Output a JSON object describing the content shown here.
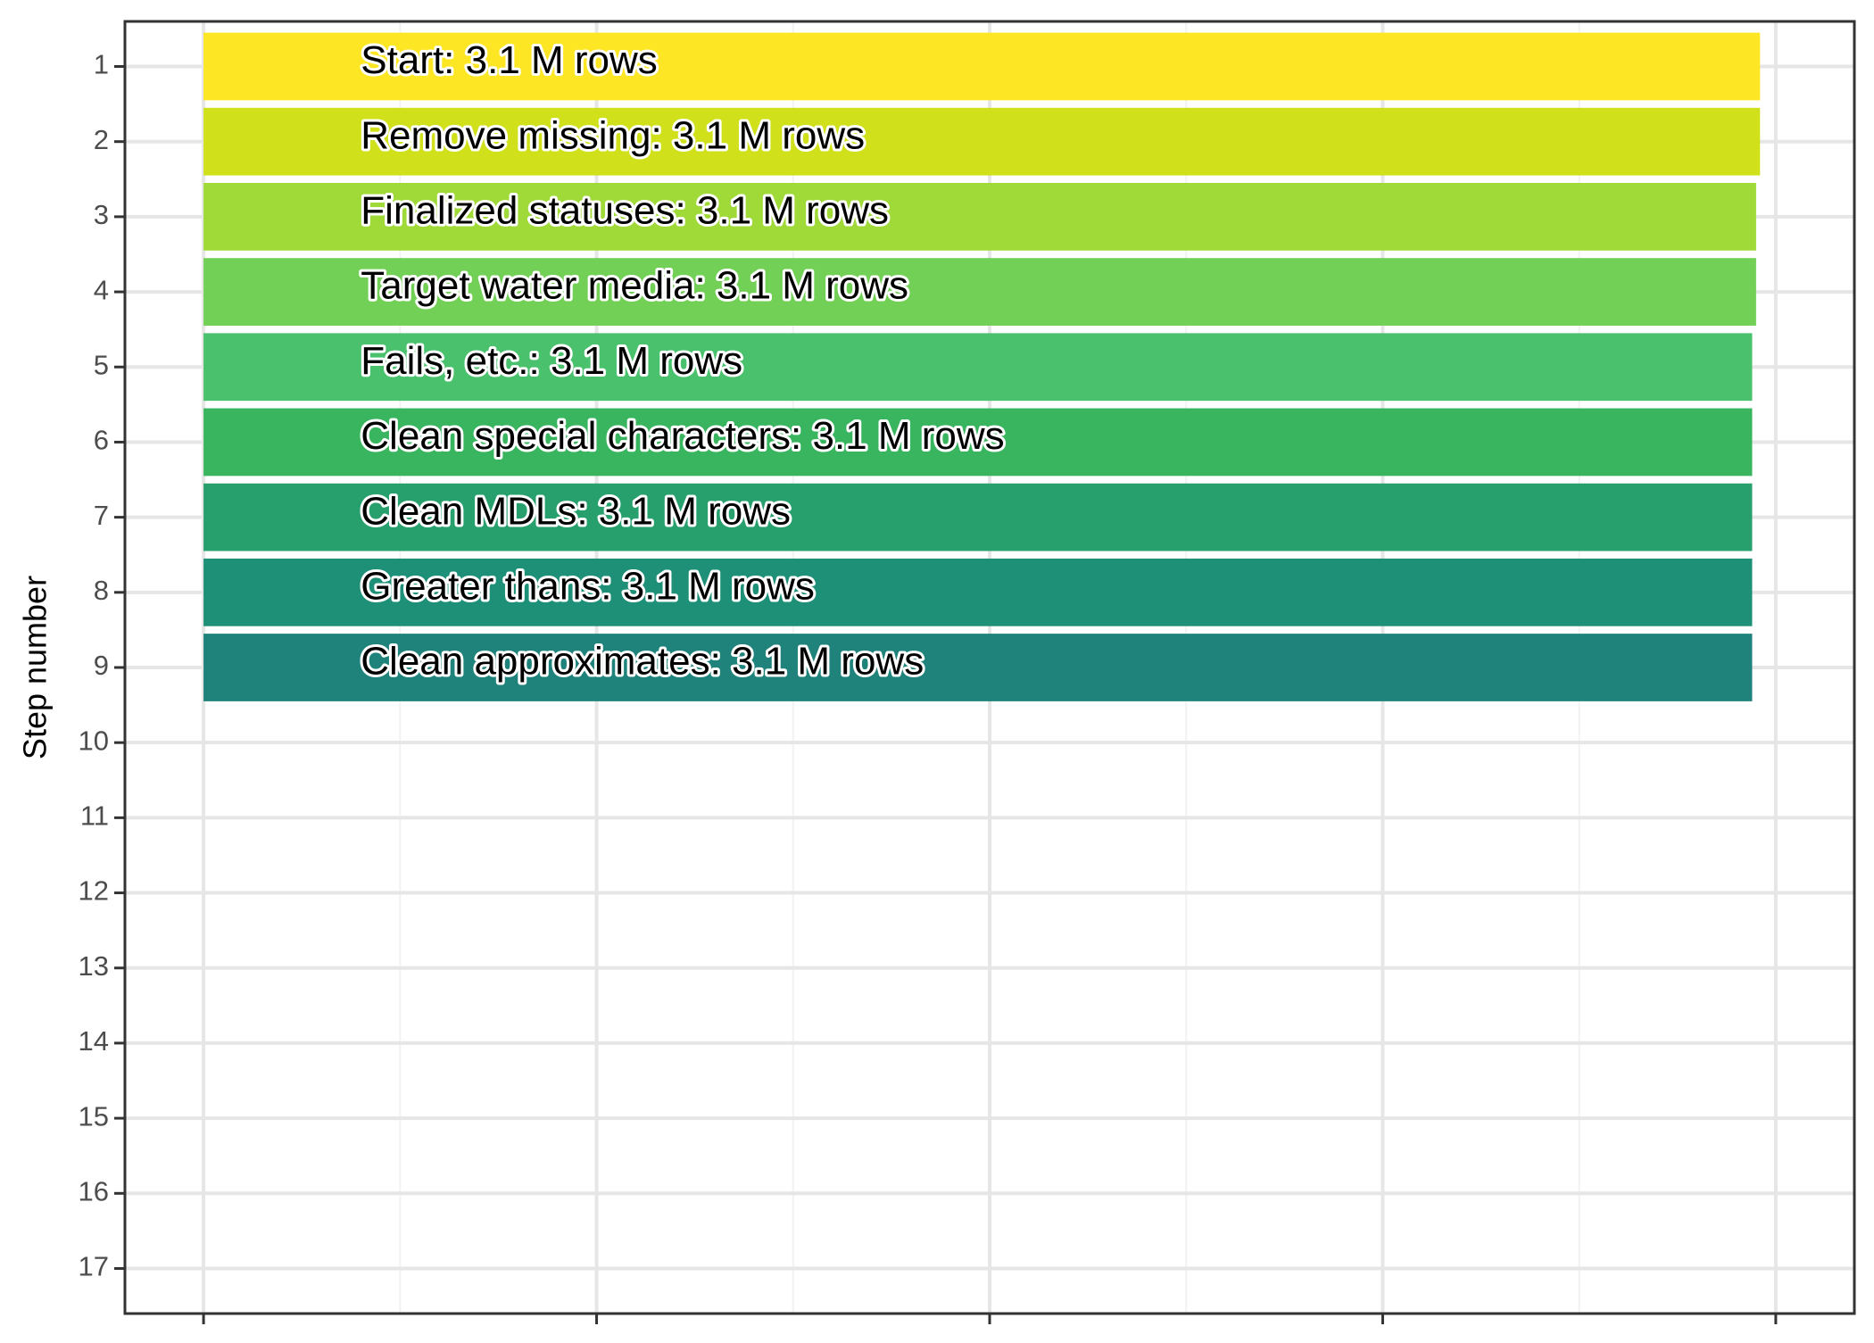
{
  "chart_data": {
    "type": "bar",
    "orientation": "horizontal",
    "title": "",
    "xlabel": "",
    "ylabel": "Step number",
    "y_ticks": [
      "1",
      "2",
      "3",
      "4",
      "5",
      "6",
      "7",
      "8",
      "9",
      "10",
      "11",
      "12",
      "13",
      "14",
      "15",
      "16",
      "17"
    ],
    "xlim": [
      0,
      4
    ],
    "x_grid_major": [
      0,
      1,
      2,
      3,
      4
    ],
    "grid": true,
    "legend": "none",
    "bars": [
      {
        "step": 1,
        "value": 3.96,
        "label": "Start:  3.1 M rows",
        "color": "#FDE725"
      },
      {
        "step": 2,
        "value": 3.96,
        "label": "Remove missing:  3.1 M rows",
        "color": "#D0E11C"
      },
      {
        "step": 3,
        "value": 3.95,
        "label": "Finalized statuses:  3.1 M rows",
        "color": "#A0DA39"
      },
      {
        "step": 4,
        "value": 3.95,
        "label": "Target water media:  3.1 M rows",
        "color": "#73D056"
      },
      {
        "step": 5,
        "value": 3.94,
        "label": "Fails, etc.:  3.1 M rows",
        "color": "#4AC16D"
      },
      {
        "step": 6,
        "value": 3.94,
        "label": "Clean special characters:  3.1 M rows",
        "color": "#3AB55F"
      },
      {
        "step": 7,
        "value": 3.94,
        "label": "Clean MDLs:  3.1 M rows",
        "color": "#28A06E"
      },
      {
        "step": 8,
        "value": 3.94,
        "label": "Greater thans:  3.1 M rows",
        "color": "#1F9078"
      },
      {
        "step": 9,
        "value": 3.94,
        "label": "Clean approximates:  3.1 M rows",
        "color": "#20837B"
      }
    ]
  }
}
